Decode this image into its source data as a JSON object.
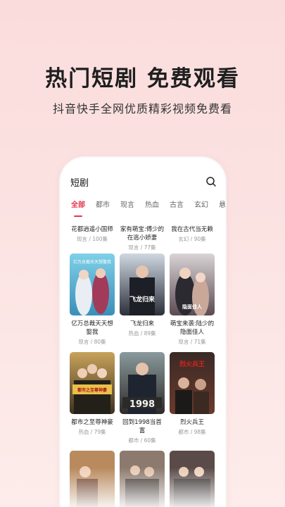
{
  "headline": "热门短剧 免费观看",
  "subline": "抖音快手全网优质精彩视频免费看",
  "search": {
    "title": "短剧",
    "icon": "search-icon"
  },
  "tabs": [
    "全部",
    "都市",
    "现言",
    "热血",
    "古言",
    "玄幻",
    "悬"
  ],
  "active_tab": "全部",
  "accent_color": "#e8364b",
  "dramas": [
    {
      "title": "花都逍遥小国师",
      "meta": "现言 / 100集"
    },
    {
      "title": "家有萌宝:傅少的在逃小娇妻",
      "meta": "现言 / 77集"
    },
    {
      "title": "我在古代当无赖",
      "meta": "玄幻 / 90集"
    },
    {
      "title": "亿万总裁天天想娶我",
      "meta": "现言 / 80集",
      "cover_text": "亿万总裁天天想娶我"
    },
    {
      "title": "飞龙归来",
      "meta": "热血 / 89集",
      "cover_text": "飞龙归来"
    },
    {
      "title": "萌宝来袭:陆少的隐面佳人",
      "meta": "现言 / 71集",
      "cover_text": "隐面佳人"
    },
    {
      "title": "都市之至尊神豪",
      "meta": "热血 / 79集",
      "cover_text": "都市之至尊神豪"
    },
    {
      "title": "回到1998当首富",
      "meta": "都市 / 60集",
      "cover_text": "1998"
    },
    {
      "title": "烈火兵王",
      "meta": "都市 / 98集",
      "cover_text": "烈火兵王"
    }
  ]
}
